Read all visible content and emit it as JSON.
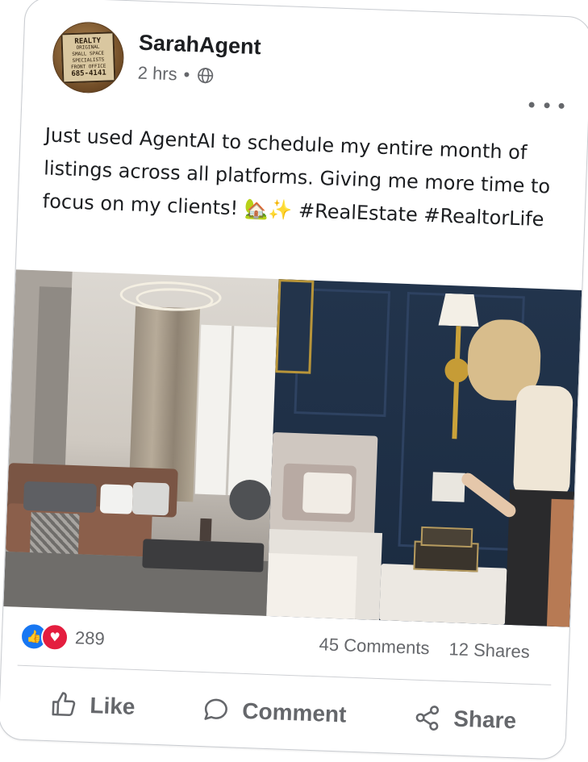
{
  "post": {
    "author": "SarahAgent",
    "time": "2 hrs",
    "separator": "•",
    "privacy_icon": "globe-icon",
    "more_icon": "more-horizontal-icon",
    "avatar_sign": {
      "line1": "REALTY",
      "line2": "ORIGINAL",
      "line3": "SMALL SPACE",
      "line4": "SPECIALISTS",
      "line5": "FRONT OFFICE",
      "line6": "685-4141"
    },
    "text": "Just used AgentAI to schedule my entire month of listings across all platforms. Giving me more time to focus on my clients! 🏡✨ #RealEstate #RealtorLife"
  },
  "stats": {
    "reaction_count": "289",
    "comments": "45 Comments",
    "shares": "12 Shares"
  },
  "actions": {
    "like": "Like",
    "comment": "Comment",
    "share": "Share"
  },
  "colors": {
    "like_blue": "#1877f2",
    "love_red": "#e41e3f",
    "muted_text": "#65676b",
    "primary_text": "#1c1e21"
  }
}
